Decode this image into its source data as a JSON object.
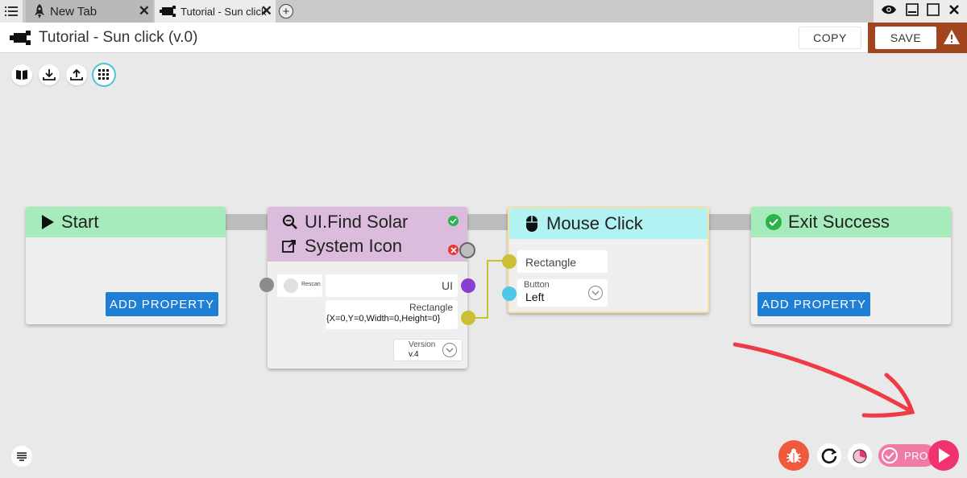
{
  "tabs": [
    {
      "label": "New Tab",
      "close": "✕"
    },
    {
      "label": "Tutorial - Sun click",
      "close": "✕"
    }
  ],
  "new_tab": "+",
  "title": "Tutorial - Sun click (v.0)",
  "header": {
    "copy_label": "COPY",
    "save_label": "SAVE"
  },
  "toolbar": {
    "items": [
      "book-icon",
      "download-icon",
      "upload-icon",
      "grid-icon"
    ],
    "active": "grid-icon"
  },
  "nodes": {
    "start": {
      "title": "Start",
      "add_property": "ADD PROPERTY",
      "color": "#a6ebbb"
    },
    "find": {
      "title_line1": "UI.Find Solar",
      "title_line2": "System Icon",
      "color": "#dcbcdc",
      "rescan_label": "Rescan",
      "ui_label": "UI",
      "rect_label": "Rectangle",
      "rect_value": "{X=0,Y=0,Width=0,Height=0}",
      "version_label": "Version",
      "version_value": "v.4"
    },
    "click": {
      "title": "Mouse Click",
      "color": "#b3f2f2",
      "rect_label": "Rectangle",
      "button_label": "Button",
      "button_value": "Left"
    },
    "exit": {
      "title": "Exit Success",
      "add_property": "ADD PROPERTY",
      "color": "#a6ebbb"
    }
  },
  "bottom": {
    "pro_label": "PRO"
  },
  "colors": {
    "accent_blue": "#1f7fd6",
    "save_bg": "#a0451d",
    "port_purple": "#8a3fd0",
    "port_yellow": "#cbbf36",
    "port_cyan": "#4fc8e8",
    "play": "#f0326e"
  }
}
